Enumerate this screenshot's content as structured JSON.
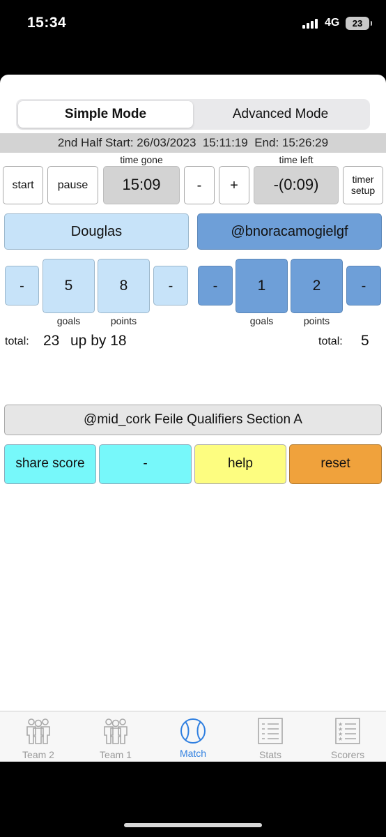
{
  "status_bar": {
    "time": "15:34",
    "network": "4G",
    "battery": "23"
  },
  "mode_toggle": {
    "simple": "Simple Mode",
    "advanced": "Advanced Mode",
    "selected": "Simple Mode"
  },
  "half_info": "2nd Half Start: 26/03/2023  15:11:19  End: 15:26:29",
  "timer": {
    "start": "start",
    "pause": "pause",
    "time_gone_label": "time gone",
    "time_gone": "15:09",
    "minus": "-",
    "plus": "+",
    "time_left_label": "time left",
    "time_left": "-(0:09)",
    "setup_line1": "timer",
    "setup_line2": "setup"
  },
  "home": {
    "name": "Douglas",
    "goals": "5",
    "points": "8",
    "goals_label": "goals",
    "points_label": "points",
    "minus": "-",
    "total_label": "total:",
    "total": "23",
    "margin": "up by 18"
  },
  "away": {
    "name": "@bnoracamogielgf",
    "goals": "1",
    "points": "2",
    "goals_label": "goals",
    "points_label": "points",
    "minus": "-",
    "total_label": "total:",
    "total": "5"
  },
  "match_title": "@mid_cork Feile Qualifiers Section A",
  "actions": {
    "share": "share score",
    "dash": "-",
    "help": "help",
    "reset": "reset"
  },
  "tabs": [
    {
      "label": "Team 2",
      "icon": "team-icon"
    },
    {
      "label": "Team 1",
      "icon": "team-icon"
    },
    {
      "label": "Match",
      "icon": "ball-icon"
    },
    {
      "label": "Stats",
      "icon": "list-icon"
    },
    {
      "label": "Scorers",
      "icon": "star-list-icon"
    }
  ],
  "colors": {
    "home_tint": "#c7e3f9",
    "away_tint": "#6e9fd8",
    "share": "#77f8fa",
    "help": "#fdfd80",
    "reset": "#f0a23c",
    "accent": "#2f7fe0"
  }
}
